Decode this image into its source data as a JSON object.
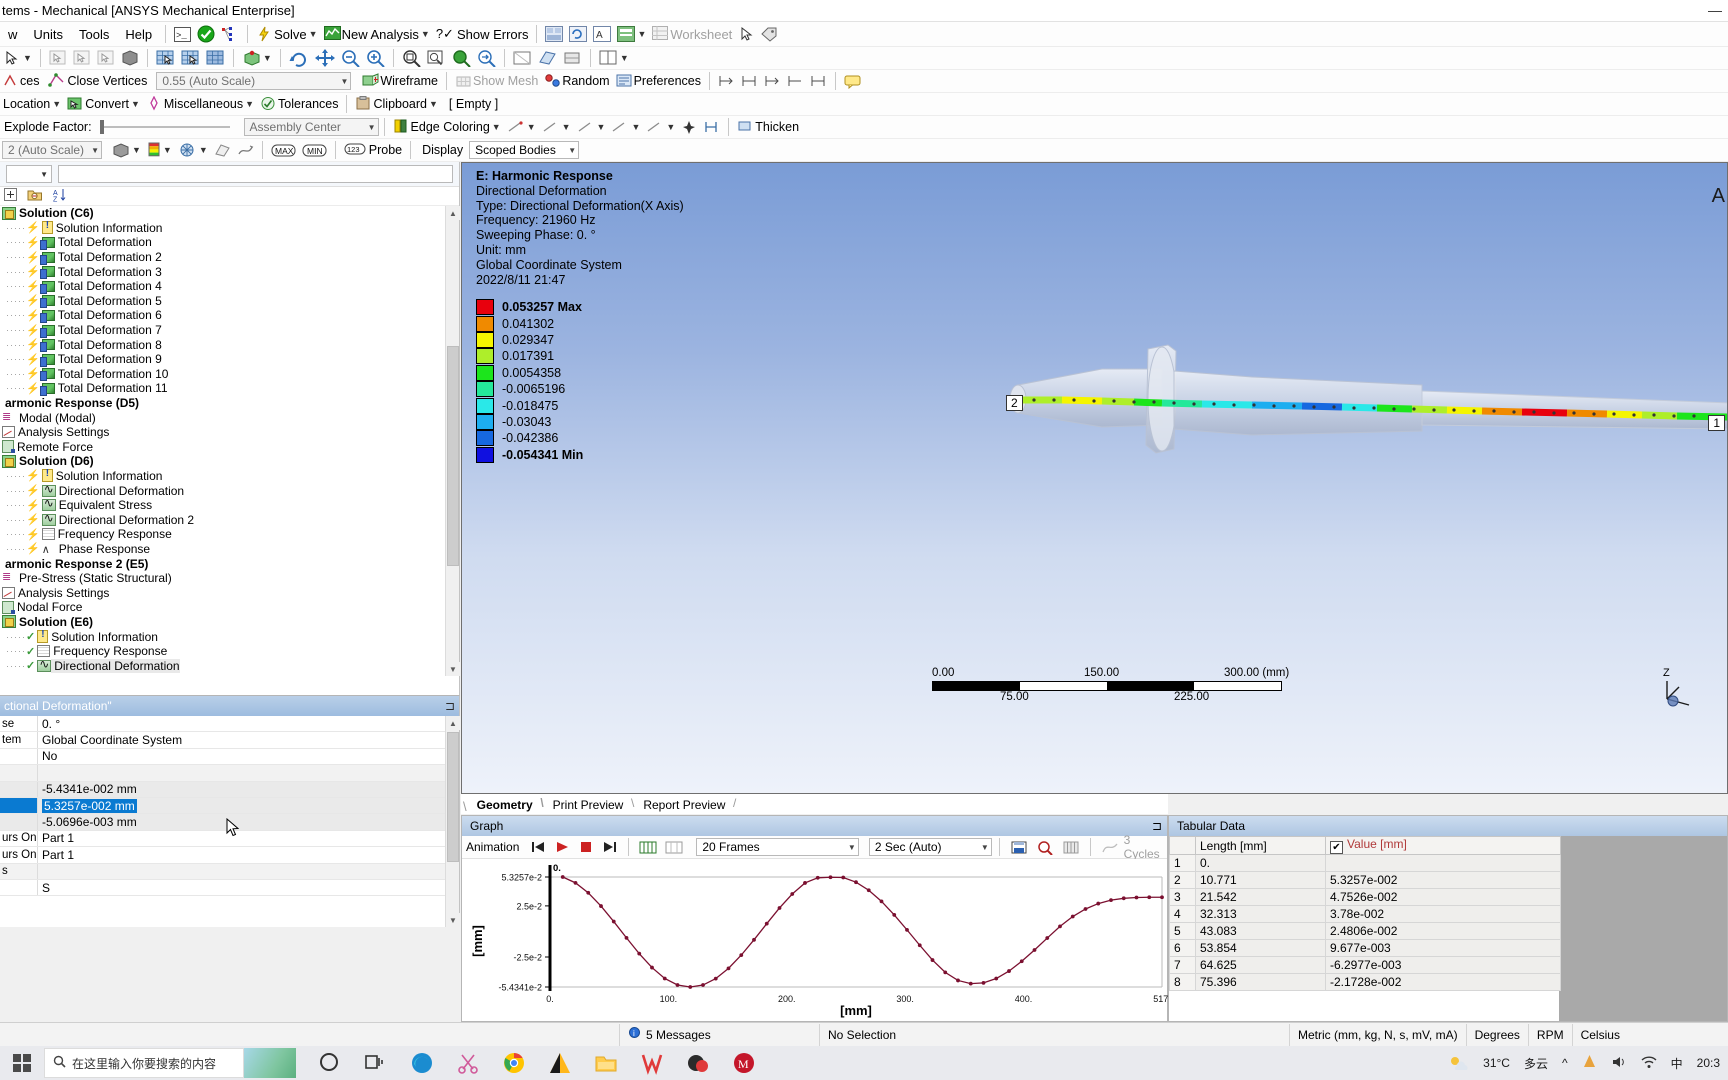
{
  "window": {
    "title": "tems - Mechanical [ANSYS Mechanical Enterprise]",
    "minimize": "—",
    "maximize": "▢",
    "close": "✕"
  },
  "menubar": {
    "items": [
      "w",
      "Units",
      "Tools",
      "Help"
    ],
    "solve_label": "Solve",
    "new_analysis_label": "New Analysis",
    "show_errors_label": "Show Errors",
    "worksheet_label": "Worksheet"
  },
  "toolbar_selection": {
    "edges_label": "ces",
    "close_vertices_label": "Close Vertices",
    "auto_scale_value": "0.55 (Auto Scale)",
    "wireframe_label": "Wireframe",
    "show_mesh_label": "Show Mesh",
    "random_label": "Random",
    "preferences_label": "Preferences"
  },
  "toolbar_location": {
    "location_label": "Location",
    "convert_label": "Convert",
    "miscellaneous_label": "Miscellaneous",
    "tolerances_label": "Tolerances",
    "clipboard_label": "Clipboard",
    "empty_label": "[ Empty ]"
  },
  "toolbar_explode": {
    "explode_factor_label": "Explode Factor:",
    "assembly_center_value": "Assembly Center",
    "edge_coloring_label": "Edge Coloring",
    "thicken_label": "Thicken"
  },
  "toolbar_result": {
    "auto_scale_value": "2 (Auto Scale)",
    "max_label": "MAX",
    "min_label": "MIN",
    "probe_label": "Probe",
    "display_label": "Display",
    "scoped_bodies_value": "Scoped Bodies"
  },
  "tree": {
    "search_placeholder": "",
    "filter_value": "",
    "items": [
      {
        "label": "Solution (C6)",
        "indent": 0,
        "bold": true,
        "icon": "solution-icon",
        "mark": ""
      },
      {
        "label": "Solution Information",
        "indent": 1,
        "bold": false,
        "icon": "note-icon",
        "mark": "bolt"
      },
      {
        "label": "Total Deformation",
        "indent": 1,
        "bold": false,
        "icon": "deformation-icon",
        "mark": "bolt"
      },
      {
        "label": "Total Deformation 2",
        "indent": 1,
        "bold": false,
        "icon": "deformation-icon",
        "mark": "bolt"
      },
      {
        "label": "Total Deformation 3",
        "indent": 1,
        "bold": false,
        "icon": "deformation-icon",
        "mark": "bolt"
      },
      {
        "label": "Total Deformation 4",
        "indent": 1,
        "bold": false,
        "icon": "deformation-icon",
        "mark": "bolt"
      },
      {
        "label": "Total Deformation 5",
        "indent": 1,
        "bold": false,
        "icon": "deformation-icon",
        "mark": "bolt"
      },
      {
        "label": "Total Deformation 6",
        "indent": 1,
        "bold": false,
        "icon": "deformation-icon",
        "mark": "bolt"
      },
      {
        "label": "Total Deformation 7",
        "indent": 1,
        "bold": false,
        "icon": "deformation-icon",
        "mark": "bolt"
      },
      {
        "label": "Total Deformation 8",
        "indent": 1,
        "bold": false,
        "icon": "deformation-icon",
        "mark": "bolt"
      },
      {
        "label": "Total Deformation 9",
        "indent": 1,
        "bold": false,
        "icon": "deformation-icon",
        "mark": "bolt"
      },
      {
        "label": "Total Deformation 10",
        "indent": 1,
        "bold": false,
        "icon": "deformation-icon",
        "mark": "bolt"
      },
      {
        "label": "Total Deformation 11",
        "indent": 1,
        "bold": false,
        "icon": "deformation-icon",
        "mark": "bolt"
      },
      {
        "label": "armonic Response (D5)",
        "indent": 0,
        "bold": true,
        "icon": "",
        "mark": ""
      },
      {
        "label": "Modal (Modal)",
        "indent": 0,
        "bold": false,
        "icon": "modal-icon",
        "mark": ""
      },
      {
        "label": "Analysis Settings",
        "indent": 0,
        "bold": false,
        "icon": "settings-icon",
        "mark": ""
      },
      {
        "label": "Remote Force",
        "indent": 0,
        "bold": false,
        "icon": "force-icon",
        "mark": ""
      },
      {
        "label": "Solution (D6)",
        "indent": 0,
        "bold": true,
        "icon": "solution-icon",
        "mark": ""
      },
      {
        "label": "Solution Information",
        "indent": 1,
        "bold": false,
        "icon": "note-icon",
        "mark": "bolt"
      },
      {
        "label": "Directional Deformation",
        "indent": 1,
        "bold": false,
        "icon": "wave-icon",
        "mark": "bolt"
      },
      {
        "label": "Equivalent Stress",
        "indent": 1,
        "bold": false,
        "icon": "wave-icon",
        "mark": "bolt"
      },
      {
        "label": "Directional Deformation 2",
        "indent": 1,
        "bold": false,
        "icon": "wave-icon",
        "mark": "bolt"
      },
      {
        "label": "Frequency Response",
        "indent": 1,
        "bold": false,
        "icon": "grid-icon",
        "mark": "bolt"
      },
      {
        "label": "Phase Response",
        "indent": 1,
        "bold": false,
        "icon": "phase-icon",
        "mark": "bolt"
      },
      {
        "label": "armonic Response 2 (E5)",
        "indent": 0,
        "bold": true,
        "icon": "",
        "mark": ""
      },
      {
        "label": "Pre-Stress (Static Structural)",
        "indent": 0,
        "bold": false,
        "icon": "modal-icon",
        "mark": ""
      },
      {
        "label": "Analysis Settings",
        "indent": 0,
        "bold": false,
        "icon": "settings-icon",
        "mark": ""
      },
      {
        "label": "Nodal Force",
        "indent": 0,
        "bold": false,
        "icon": "force-icon",
        "mark": ""
      },
      {
        "label": "Solution (E6)",
        "indent": 0,
        "bold": true,
        "icon": "solution-icon",
        "mark": ""
      },
      {
        "label": "Solution Information",
        "indent": 1,
        "bold": false,
        "icon": "note-icon",
        "mark": "check"
      },
      {
        "label": "Frequency Response",
        "indent": 1,
        "bold": false,
        "icon": "grid-icon",
        "mark": "check"
      },
      {
        "label": "Directional Deformation",
        "indent": 1,
        "bold": false,
        "icon": "wave-icon",
        "mark": "check",
        "selected": true
      }
    ]
  },
  "details": {
    "title": "ctional Deformation\"",
    "rows": [
      {
        "name": "se",
        "value": "0. °",
        "shaded": false
      },
      {
        "name": "tem",
        "value": "Global Coordinate System",
        "shaded": false
      },
      {
        "name": "",
        "value": "No",
        "shaded": false
      },
      {
        "name": "",
        "value": "",
        "shaded": false,
        "section": true
      },
      {
        "name": "",
        "value": "-5.4341e-002 mm",
        "shaded": true
      },
      {
        "name": "",
        "value": "5.3257e-002 mm",
        "shaded": true,
        "selected": true
      },
      {
        "name": "",
        "value": "-5.0696e-003 mm",
        "shaded": true
      },
      {
        "name": "urs On",
        "value": "Part 1",
        "shaded": false
      },
      {
        "name": "urs On",
        "value": "Part 1",
        "shaded": false
      },
      {
        "name": "s",
        "value": "",
        "shaded": false,
        "section": true
      },
      {
        "name": "",
        "value": "S",
        "shaded": false
      }
    ]
  },
  "viewport": {
    "header_lines": [
      {
        "text": "E: Harmonic Response",
        "bold": true
      },
      {
        "text": "Directional Deformation",
        "bold": false
      },
      {
        "text": "Type: Directional Deformation(X Axis)",
        "bold": false
      },
      {
        "text": "Frequency: 21960 Hz",
        "bold": false
      },
      {
        "text": "Sweeping Phase: 0. °",
        "bold": false
      },
      {
        "text": "Unit: mm",
        "bold": false
      },
      {
        "text": "Global Coordinate System",
        "bold": false
      },
      {
        "text": "2022/8/11 21:47",
        "bold": false
      }
    ],
    "legend": [
      {
        "label": "0.053257 Max",
        "color": "#e8000d",
        "bold": true
      },
      {
        "label": "0.041302",
        "color": "#f08a00",
        "bold": false
      },
      {
        "label": "0.029347",
        "color": "#f5f500",
        "bold": false
      },
      {
        "label": "0.017391",
        "color": "#aeee2a",
        "bold": false
      },
      {
        "label": "0.0054358",
        "color": "#1ce51c",
        "bold": false
      },
      {
        "label": "-0.0065196",
        "color": "#24e89a",
        "bold": false
      },
      {
        "label": "-0.018475",
        "color": "#2ae8e8",
        "bold": false
      },
      {
        "label": "-0.03043",
        "color": "#1daef0",
        "bold": false
      },
      {
        "label": "-0.042386",
        "color": "#1668e0",
        "bold": false
      },
      {
        "label": "-0.054341 Min",
        "color": "#1010e0",
        "bold": true
      }
    ],
    "scale_top": [
      "0.00",
      "150.00",
      "300.00 (mm)"
    ],
    "scale_bottom": [
      "75.00",
      "225.00"
    ],
    "probe_label_1": "2",
    "probe_label_2": "1",
    "axis_z_label": "Z",
    "axis_corner_label": "A"
  },
  "viewport_tabs": [
    {
      "label": "Geometry",
      "active": true
    },
    {
      "label": "Print Preview",
      "active": false
    },
    {
      "label": "Report Preview",
      "active": false
    }
  ],
  "graph": {
    "title": "Graph",
    "animation_label": "Animation",
    "frames_value": "20 Frames",
    "duration_value": "2 Sec (Auto)",
    "cycles_label": "3 Cycles"
  },
  "chart_data": {
    "type": "line",
    "title": "",
    "xlabel": "[mm]",
    "ylabel": "[mm]",
    "xlim": [
      0,
      517
    ],
    "ylim": [
      -0.054341,
      0.053257
    ],
    "xticks": [
      "0.",
      "100.",
      "200.",
      "300.",
      "400.",
      "517."
    ],
    "xtick_values": [
      0,
      100,
      200,
      300,
      400,
      517
    ],
    "yticks": [
      "5.3257e-2",
      "2.5e-2",
      "-2.5e-2",
      "-5.4341e-2"
    ],
    "ytick_values": [
      0.053257,
      0.025,
      -0.025,
      -0.054341
    ],
    "origin_label": "0.",
    "series": [
      {
        "name": "Directional Deformation",
        "color": "#7b1030",
        "x": [
          10.771,
          21.542,
          32.313,
          43.083,
          53.854,
          64.625,
          75.396,
          86.167,
          96.938,
          107.708,
          118.479,
          129.25,
          140.021,
          150.792,
          161.563,
          172.333,
          183.104,
          193.875,
          204.646,
          215.417,
          226.188,
          236.958,
          247.729,
          258.5,
          269.271,
          280.042,
          290.813,
          301.583,
          312.354,
          323.125,
          333.896,
          344.667,
          355.438,
          366.208,
          376.979,
          387.75,
          398.521,
          409.292,
          420.063,
          430.833,
          441.604,
          452.375,
          463.146,
          473.917,
          484.688,
          495.458,
          506.229,
          517.0
        ],
        "y": [
          0.053257,
          0.047526,
          0.0378,
          0.024806,
          0.009677,
          -0.0062977,
          -0.021728,
          -0.035338,
          -0.046002,
          -0.052353,
          -0.054341,
          -0.05241,
          -0.046113,
          -0.036088,
          -0.023153,
          -0.008198,
          0.007591,
          0.022949,
          0.036606,
          0.04744,
          0.05248,
          0.053044,
          0.052786,
          0.048174,
          0.04033,
          0.029423,
          0.016167,
          0.001535,
          -0.013497,
          -0.028001,
          -0.040039,
          -0.047939,
          -0.05106,
          -0.050285,
          -0.046077,
          -0.038767,
          -0.029187,
          -0.018117,
          -0.00646,
          0.004944,
          0.01459,
          0.021967,
          0.027265,
          0.03062,
          0.032411,
          0.033179,
          0.033438,
          0.033479
        ]
      }
    ]
  },
  "tabular": {
    "title": "Tabular Data",
    "columns": [
      "",
      "Length [mm]",
      "Value [mm]"
    ],
    "rows": [
      {
        "idx": "1",
        "length": "0.",
        "value": ""
      },
      {
        "idx": "2",
        "length": "10.771",
        "value": "5.3257e-002"
      },
      {
        "idx": "3",
        "length": "21.542",
        "value": "4.7526e-002"
      },
      {
        "idx": "4",
        "length": "32.313",
        "value": "3.78e-002"
      },
      {
        "idx": "5",
        "length": "43.083",
        "value": "2.4806e-002"
      },
      {
        "idx": "6",
        "length": "53.854",
        "value": "9.677e-003"
      },
      {
        "idx": "7",
        "length": "64.625",
        "value": "-6.2977e-003"
      },
      {
        "idx": "8",
        "length": "75.396",
        "value": "-2.1728e-002"
      }
    ]
  },
  "statusbar": {
    "messages": "5 Messages",
    "selection": "No Selection",
    "units": "Metric (mm, kg, N, s, mV, mA)",
    "angle": "Degrees",
    "rotation": "RPM",
    "temperature": "Celsius"
  },
  "taskbar": {
    "search_placeholder": "在这里输入你要搜索的内容",
    "weather_temp": "31°C",
    "weather_desc": "多云",
    "clock": "20:3"
  }
}
